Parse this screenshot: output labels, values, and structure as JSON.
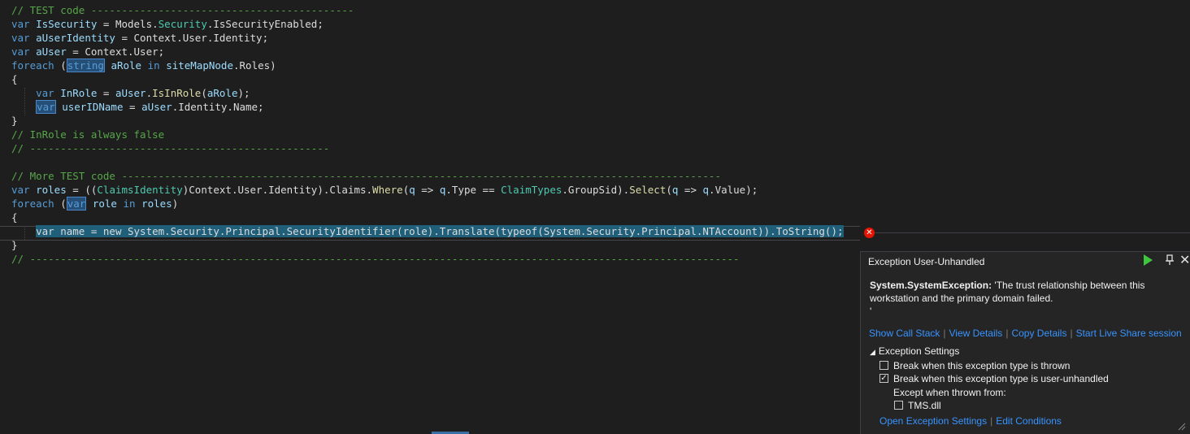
{
  "code_lines": [
    [
      {
        "c": "cm",
        "t": "// TEST code -------------------------------------------"
      }
    ],
    [
      {
        "c": "kw",
        "t": "var"
      },
      {
        "c": "pl",
        "t": " "
      },
      {
        "c": "vr",
        "t": "IsSecurity"
      },
      {
        "c": "pl",
        "t": " = Models."
      },
      {
        "c": "ty",
        "t": "Security"
      },
      {
        "c": "pl",
        "t": ".IsSecurityEnabled;"
      }
    ],
    [
      {
        "c": "kw",
        "t": "var"
      },
      {
        "c": "pl",
        "t": " "
      },
      {
        "c": "vr",
        "t": "aUserIdentity"
      },
      {
        "c": "pl",
        "t": " = Context.User.Identity;"
      }
    ],
    [
      {
        "c": "kw",
        "t": "var"
      },
      {
        "c": "pl",
        "t": " "
      },
      {
        "c": "vr",
        "t": "aUser"
      },
      {
        "c": "pl",
        "t": " = Context.User;"
      }
    ],
    [
      {
        "c": "kw",
        "t": "foreach"
      },
      {
        "c": "pl",
        "t": " ("
      },
      {
        "c": "kw hl",
        "t": "string"
      },
      {
        "c": "pl",
        "t": " "
      },
      {
        "c": "vr",
        "t": "aRole"
      },
      {
        "c": "pl",
        "t": " "
      },
      {
        "c": "kw",
        "t": "in"
      },
      {
        "c": "pl",
        "t": " "
      },
      {
        "c": "vr",
        "t": "siteMapNode"
      },
      {
        "c": "pl",
        "t": ".Roles)"
      }
    ],
    [
      {
        "c": "pl",
        "t": "{"
      }
    ],
    [
      {
        "c": "pl",
        "t": "    "
      },
      {
        "c": "kw",
        "t": "var"
      },
      {
        "c": "pl",
        "t": " "
      },
      {
        "c": "vr",
        "t": "InRole"
      },
      {
        "c": "pl",
        "t": " = "
      },
      {
        "c": "vr",
        "t": "aUser"
      },
      {
        "c": "pl",
        "t": "."
      },
      {
        "c": "fn",
        "t": "IsInRole"
      },
      {
        "c": "pl",
        "t": "("
      },
      {
        "c": "vr",
        "t": "aRole"
      },
      {
        "c": "pl",
        "t": ");"
      }
    ],
    [
      {
        "c": "pl",
        "t": "    "
      },
      {
        "c": "kw hl",
        "t": "var"
      },
      {
        "c": "pl",
        "t": " "
      },
      {
        "c": "vr",
        "t": "userIDName"
      },
      {
        "c": "pl",
        "t": " = "
      },
      {
        "c": "vr",
        "t": "aUser"
      },
      {
        "c": "pl",
        "t": ".Identity.Name;"
      }
    ],
    [
      {
        "c": "pl",
        "t": "}"
      }
    ],
    [
      {
        "c": "cm",
        "t": "// InRole is always false"
      }
    ],
    [
      {
        "c": "cm",
        "t": "// -------------------------------------------------"
      }
    ],
    [],
    [
      {
        "c": "cm",
        "t": "// More TEST code --------------------------------------------------------------------------------------------------"
      }
    ],
    [
      {
        "c": "kw",
        "t": "var"
      },
      {
        "c": "pl",
        "t": " "
      },
      {
        "c": "vr",
        "t": "roles"
      },
      {
        "c": "pl",
        "t": " = (("
      },
      {
        "c": "ty",
        "t": "ClaimsIdentity"
      },
      {
        "c": "pl",
        "t": ")Context.User.Identity).Claims."
      },
      {
        "c": "fn",
        "t": "Where"
      },
      {
        "c": "pl",
        "t": "("
      },
      {
        "c": "vr",
        "t": "q"
      },
      {
        "c": "pl",
        "t": " => "
      },
      {
        "c": "vr",
        "t": "q"
      },
      {
        "c": "pl",
        "t": ".Type == "
      },
      {
        "c": "ty",
        "t": "ClaimTypes"
      },
      {
        "c": "pl",
        "t": ".GroupSid)."
      },
      {
        "c": "fn",
        "t": "Select"
      },
      {
        "c": "pl",
        "t": "("
      },
      {
        "c": "vr",
        "t": "q"
      },
      {
        "c": "pl",
        "t": " => "
      },
      {
        "c": "vr",
        "t": "q"
      },
      {
        "c": "pl",
        "t": ".Value);"
      }
    ],
    [
      {
        "c": "kw",
        "t": "foreach"
      },
      {
        "c": "pl",
        "t": " ("
      },
      {
        "c": "kw hl",
        "t": "var"
      },
      {
        "c": "pl",
        "t": " "
      },
      {
        "c": "vr",
        "t": "role"
      },
      {
        "c": "pl",
        "t": " "
      },
      {
        "c": "kw",
        "t": "in"
      },
      {
        "c": "pl",
        "t": " "
      },
      {
        "c": "vr",
        "t": "roles"
      },
      {
        "c": "pl",
        "t": ")"
      }
    ],
    [
      {
        "c": "pl",
        "t": "{"
      }
    ],
    [
      {
        "c": "pl",
        "t": "    "
      },
      {
        "c": "pl sel",
        "t": "var name = new System.Security.Principal.SecurityIdentifier(role).Translate(typeof(System.Security.Principal.NTAccount)).ToString();"
      }
    ],
    [
      {
        "c": "pl",
        "t": "}"
      }
    ],
    [
      {
        "c": "cm",
        "t": "// --------------------------------------------------------------------------------------------------------------------"
      }
    ]
  ],
  "exception": {
    "title": "Exception User-Unhandled",
    "type": "System.SystemException:",
    "message": " 'The trust relationship between this workstation and the primary domain failed.",
    "message_tail": "'",
    "links": [
      "Show Call Stack",
      "View Details",
      "Copy Details",
      "Start Live Share session"
    ],
    "settings_header": "Exception Settings",
    "break_thrown": {
      "label": "Break when this exception type is thrown",
      "checked": false
    },
    "break_unhandled": {
      "label": "Break when this exception type is user-unhandled",
      "checked": true
    },
    "except_label": "Except when thrown from:",
    "tms": {
      "label": "TMS.dll",
      "checked": false
    },
    "bottom_links": [
      "Open Exception Settings",
      "Edit Conditions"
    ]
  },
  "colors": {
    "keyword": "#569cd6",
    "type": "#4ec9b0",
    "method": "#dcdcaa",
    "variable": "#9cdcfe",
    "comment": "#57a64a",
    "error": "#e51400",
    "link": "#3794ff"
  }
}
